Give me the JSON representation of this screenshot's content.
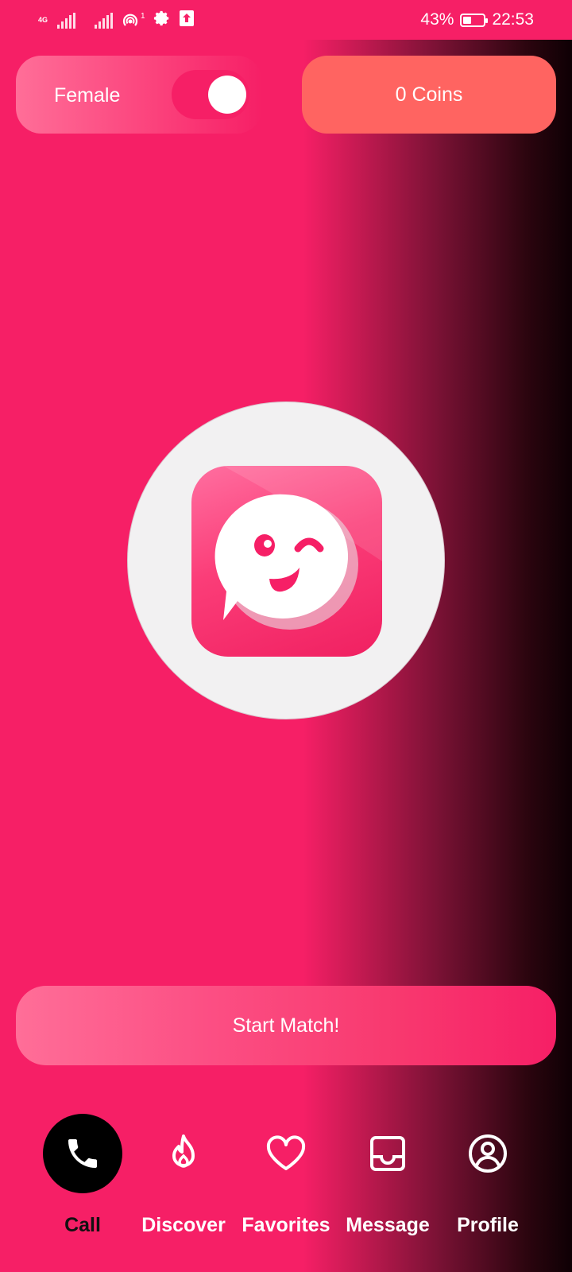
{
  "status_bar": {
    "network": "4G",
    "hotspot_count": "1",
    "battery_level": 0.43,
    "battery_text": "43%",
    "time": "22:53"
  },
  "gender_toggle": {
    "label": "Female",
    "on": true
  },
  "coins": {
    "label": "0 Coins"
  },
  "app_logo": {
    "icon": "winking-chat-bubble-logo"
  },
  "start_match": {
    "label": "Start Match!"
  },
  "bottom_nav": {
    "items": [
      {
        "label": "Call",
        "icon": "phone-icon",
        "active": true
      },
      {
        "label": "Discover",
        "icon": "flame-icon",
        "active": false
      },
      {
        "label": "Favorites",
        "icon": "heart-icon",
        "active": false
      },
      {
        "label": "Message",
        "icon": "inbox-icon",
        "active": false
      },
      {
        "label": "Profile",
        "icon": "profile-icon",
        "active": false
      }
    ]
  },
  "colors": {
    "primary": "#f61f66",
    "coins": "#ff6461",
    "nav_active": "#000000"
  }
}
